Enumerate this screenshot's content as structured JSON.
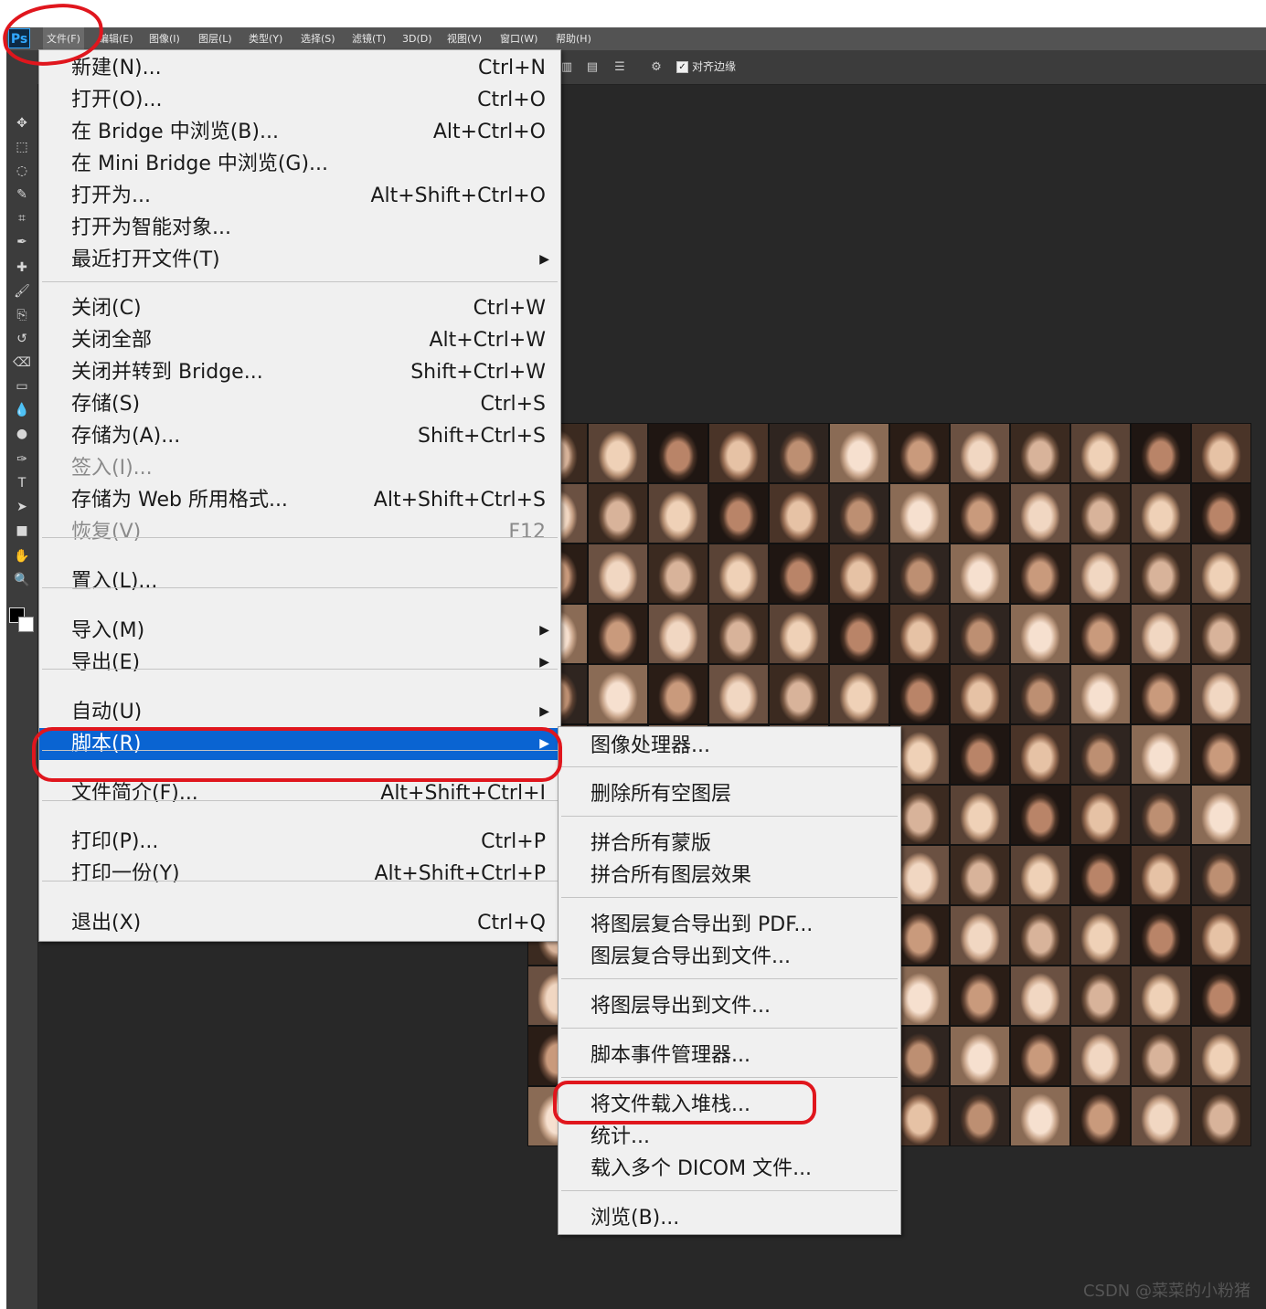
{
  "app": {
    "logo": "Ps",
    "menubar": [
      "文件(F)",
      "编辑(E)",
      "图像(I)",
      "图层(L)",
      "类型(Y)",
      "选择(S)",
      "滤镜(T)",
      "3D(D)",
      "视图(V)",
      "窗口(W)",
      "帮助(H)"
    ],
    "options": {
      "align_edges_label": "对齐边缘",
      "align_edges_checked": true
    }
  },
  "tools": [
    "move-tool",
    "marquee-tool",
    "lasso-tool",
    "quick-select-tool",
    "crop-tool",
    "eyedropper-tool",
    "healing-brush-tool",
    "brush-tool",
    "clone-stamp-tool",
    "history-brush-tool",
    "eraser-tool",
    "gradient-tool",
    "blur-tool",
    "dodge-tool",
    "pen-tool",
    "type-tool",
    "path-select-tool",
    "rectangle-tool",
    "hand-tool",
    "zoom-tool"
  ],
  "file_menu": {
    "items": [
      {
        "label": "新建(N)...",
        "shortcut": "Ctrl+N"
      },
      {
        "label": "打开(O)...",
        "shortcut": "Ctrl+O"
      },
      {
        "label": "在 Bridge 中浏览(B)...",
        "shortcut": "Alt+Ctrl+O"
      },
      {
        "label": "在 Mini Bridge 中浏览(G)...",
        "shortcut": ""
      },
      {
        "label": "打开为...",
        "shortcut": "Alt+Shift+Ctrl+O"
      },
      {
        "label": "打开为智能对象...",
        "shortcut": ""
      },
      {
        "label": "最近打开文件(T)",
        "shortcut": "",
        "submenu": true
      },
      {
        "label": "关闭(C)",
        "shortcut": "Ctrl+W"
      },
      {
        "label": "关闭全部",
        "shortcut": "Alt+Ctrl+W"
      },
      {
        "label": "关闭并转到 Bridge...",
        "shortcut": "Shift+Ctrl+W"
      },
      {
        "label": "存储(S)",
        "shortcut": "Ctrl+S"
      },
      {
        "label": "存储为(A)...",
        "shortcut": "Shift+Ctrl+S"
      },
      {
        "label": "签入(I)...",
        "shortcut": "",
        "disabled": true
      },
      {
        "label": "存储为 Web 所用格式...",
        "shortcut": "Alt+Shift+Ctrl+S"
      },
      {
        "label": "恢复(V)",
        "shortcut": "F12",
        "disabled": true
      },
      {
        "label": "置入(L)...",
        "shortcut": ""
      },
      {
        "label": "导入(M)",
        "shortcut": "",
        "submenu": true
      },
      {
        "label": "导出(E)",
        "shortcut": "",
        "submenu": true
      },
      {
        "label": "自动(U)",
        "shortcut": "",
        "submenu": true
      },
      {
        "label": "脚本(R)",
        "shortcut": "",
        "submenu": true,
        "highlighted": true
      },
      {
        "label": "文件简介(F)...",
        "shortcut": "Alt+Shift+Ctrl+I"
      },
      {
        "label": "打印(P)...",
        "shortcut": "Ctrl+P"
      },
      {
        "label": "打印一份(Y)",
        "shortcut": "Alt+Shift+Ctrl+P"
      },
      {
        "label": "退出(X)",
        "shortcut": "Ctrl+Q"
      }
    ]
  },
  "scripts_submenu": {
    "items": [
      "图像处理器...",
      "删除所有空图层",
      "拼合所有蒙版",
      "拼合所有图层效果",
      "将图层复合导出到 PDF...",
      "图层复合导出到文件...",
      "将图层导出到文件...",
      "脚本事件管理器...",
      "将文件载入堆栈...",
      "统计...",
      "载入多个 DICOM 文件...",
      "浏览(B)..."
    ]
  },
  "colors": {
    "highlight": "#0a64d2",
    "annotation": "#e0161d",
    "menu_bg": "#f0f0f0",
    "app_bg": "#282828"
  },
  "watermark": "CSDN @菜菜的小粉猪"
}
